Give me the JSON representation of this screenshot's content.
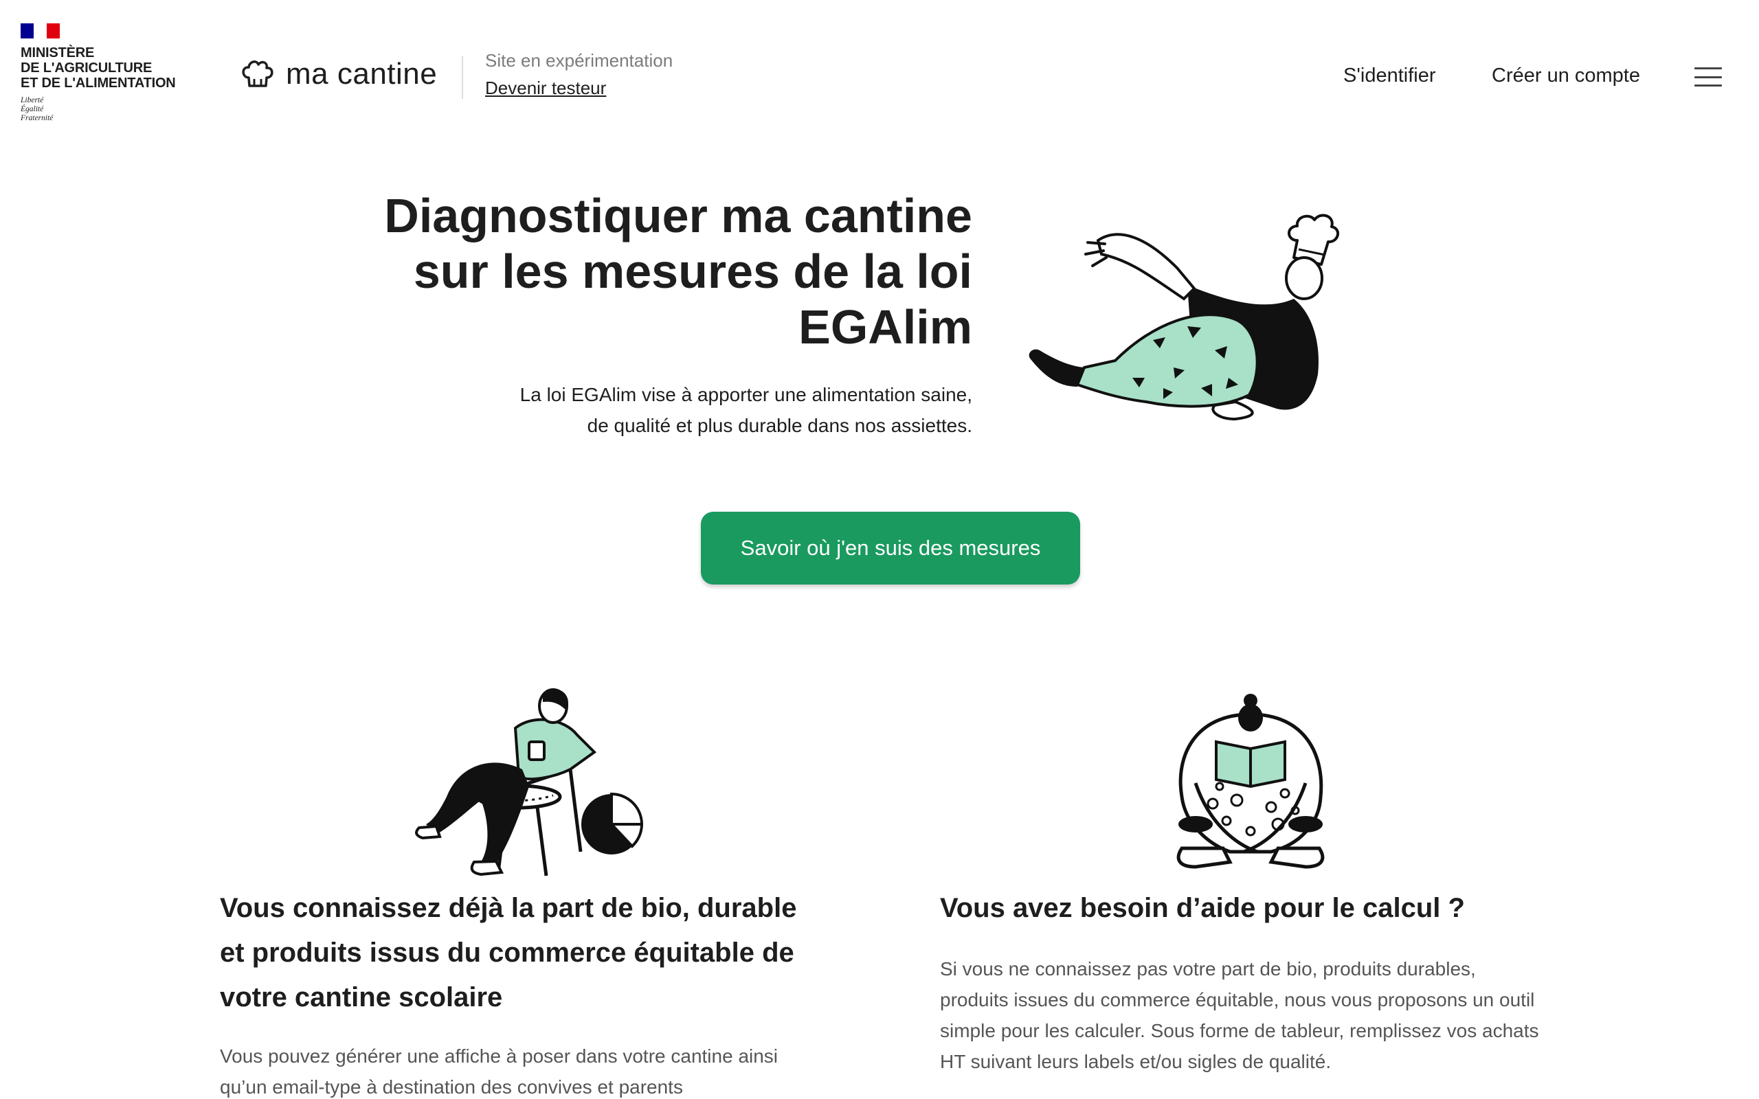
{
  "header": {
    "ministry": {
      "flag_colors": [
        "#000091",
        "#ffffff",
        "#e1000f"
      ],
      "name_lines": [
        "Ministère",
        "de l'Agriculture",
        "et de l'Alimentation"
      ],
      "motto_lines": [
        "Liberté",
        "Égalité",
        "Fraternité"
      ]
    },
    "brand": {
      "name": "ma cantine",
      "icon": "chef-hat-icon",
      "status": "Site en expérimentation",
      "tester_link": "Devenir testeur"
    },
    "nav": {
      "login": "S'identifier",
      "signup": "Créer un compte",
      "menu_icon": "hamburger-menu-icon"
    }
  },
  "hero": {
    "title": "Diagnostiquer ma cantine sur les mesures de la loi EGAlim",
    "description_lines": [
      "La loi EGAlim vise à apporter une alimentation saine,",
      "de qualité et plus durable dans nos assiettes."
    ],
    "illustration": "chef-lying-illustration",
    "cta_label": "Savoir où j'en suis des mesures"
  },
  "cards": [
    {
      "illustration": "person-chair-pie-chart-illustration",
      "title": "Vous connaissez déjà la part de bio, durable et produits issus du commerce équitable de votre cantine scolaire",
      "text": "Vous pouvez générer une affiche à poser dans votre cantine ainsi qu’un email-type à destination des convives et parents"
    },
    {
      "illustration": "person-reading-book-illustration",
      "title": "Vous avez besoin d’aide pour le calcul ?",
      "text": "Si vous ne connaissez pas votre part de bio, produits durables, produits issues du commerce équitable, nous vous proposons un outil simple pour les calculer. Sous forme de tableur, remplissez vos achats HT suivant leurs labels et/ou sigles de qualité."
    }
  ],
  "colors": {
    "accent": "#1a9a5f",
    "illustration_mint": "#a8e0c8",
    "text": "#1e1e1e",
    "muted_text": "#555555"
  }
}
